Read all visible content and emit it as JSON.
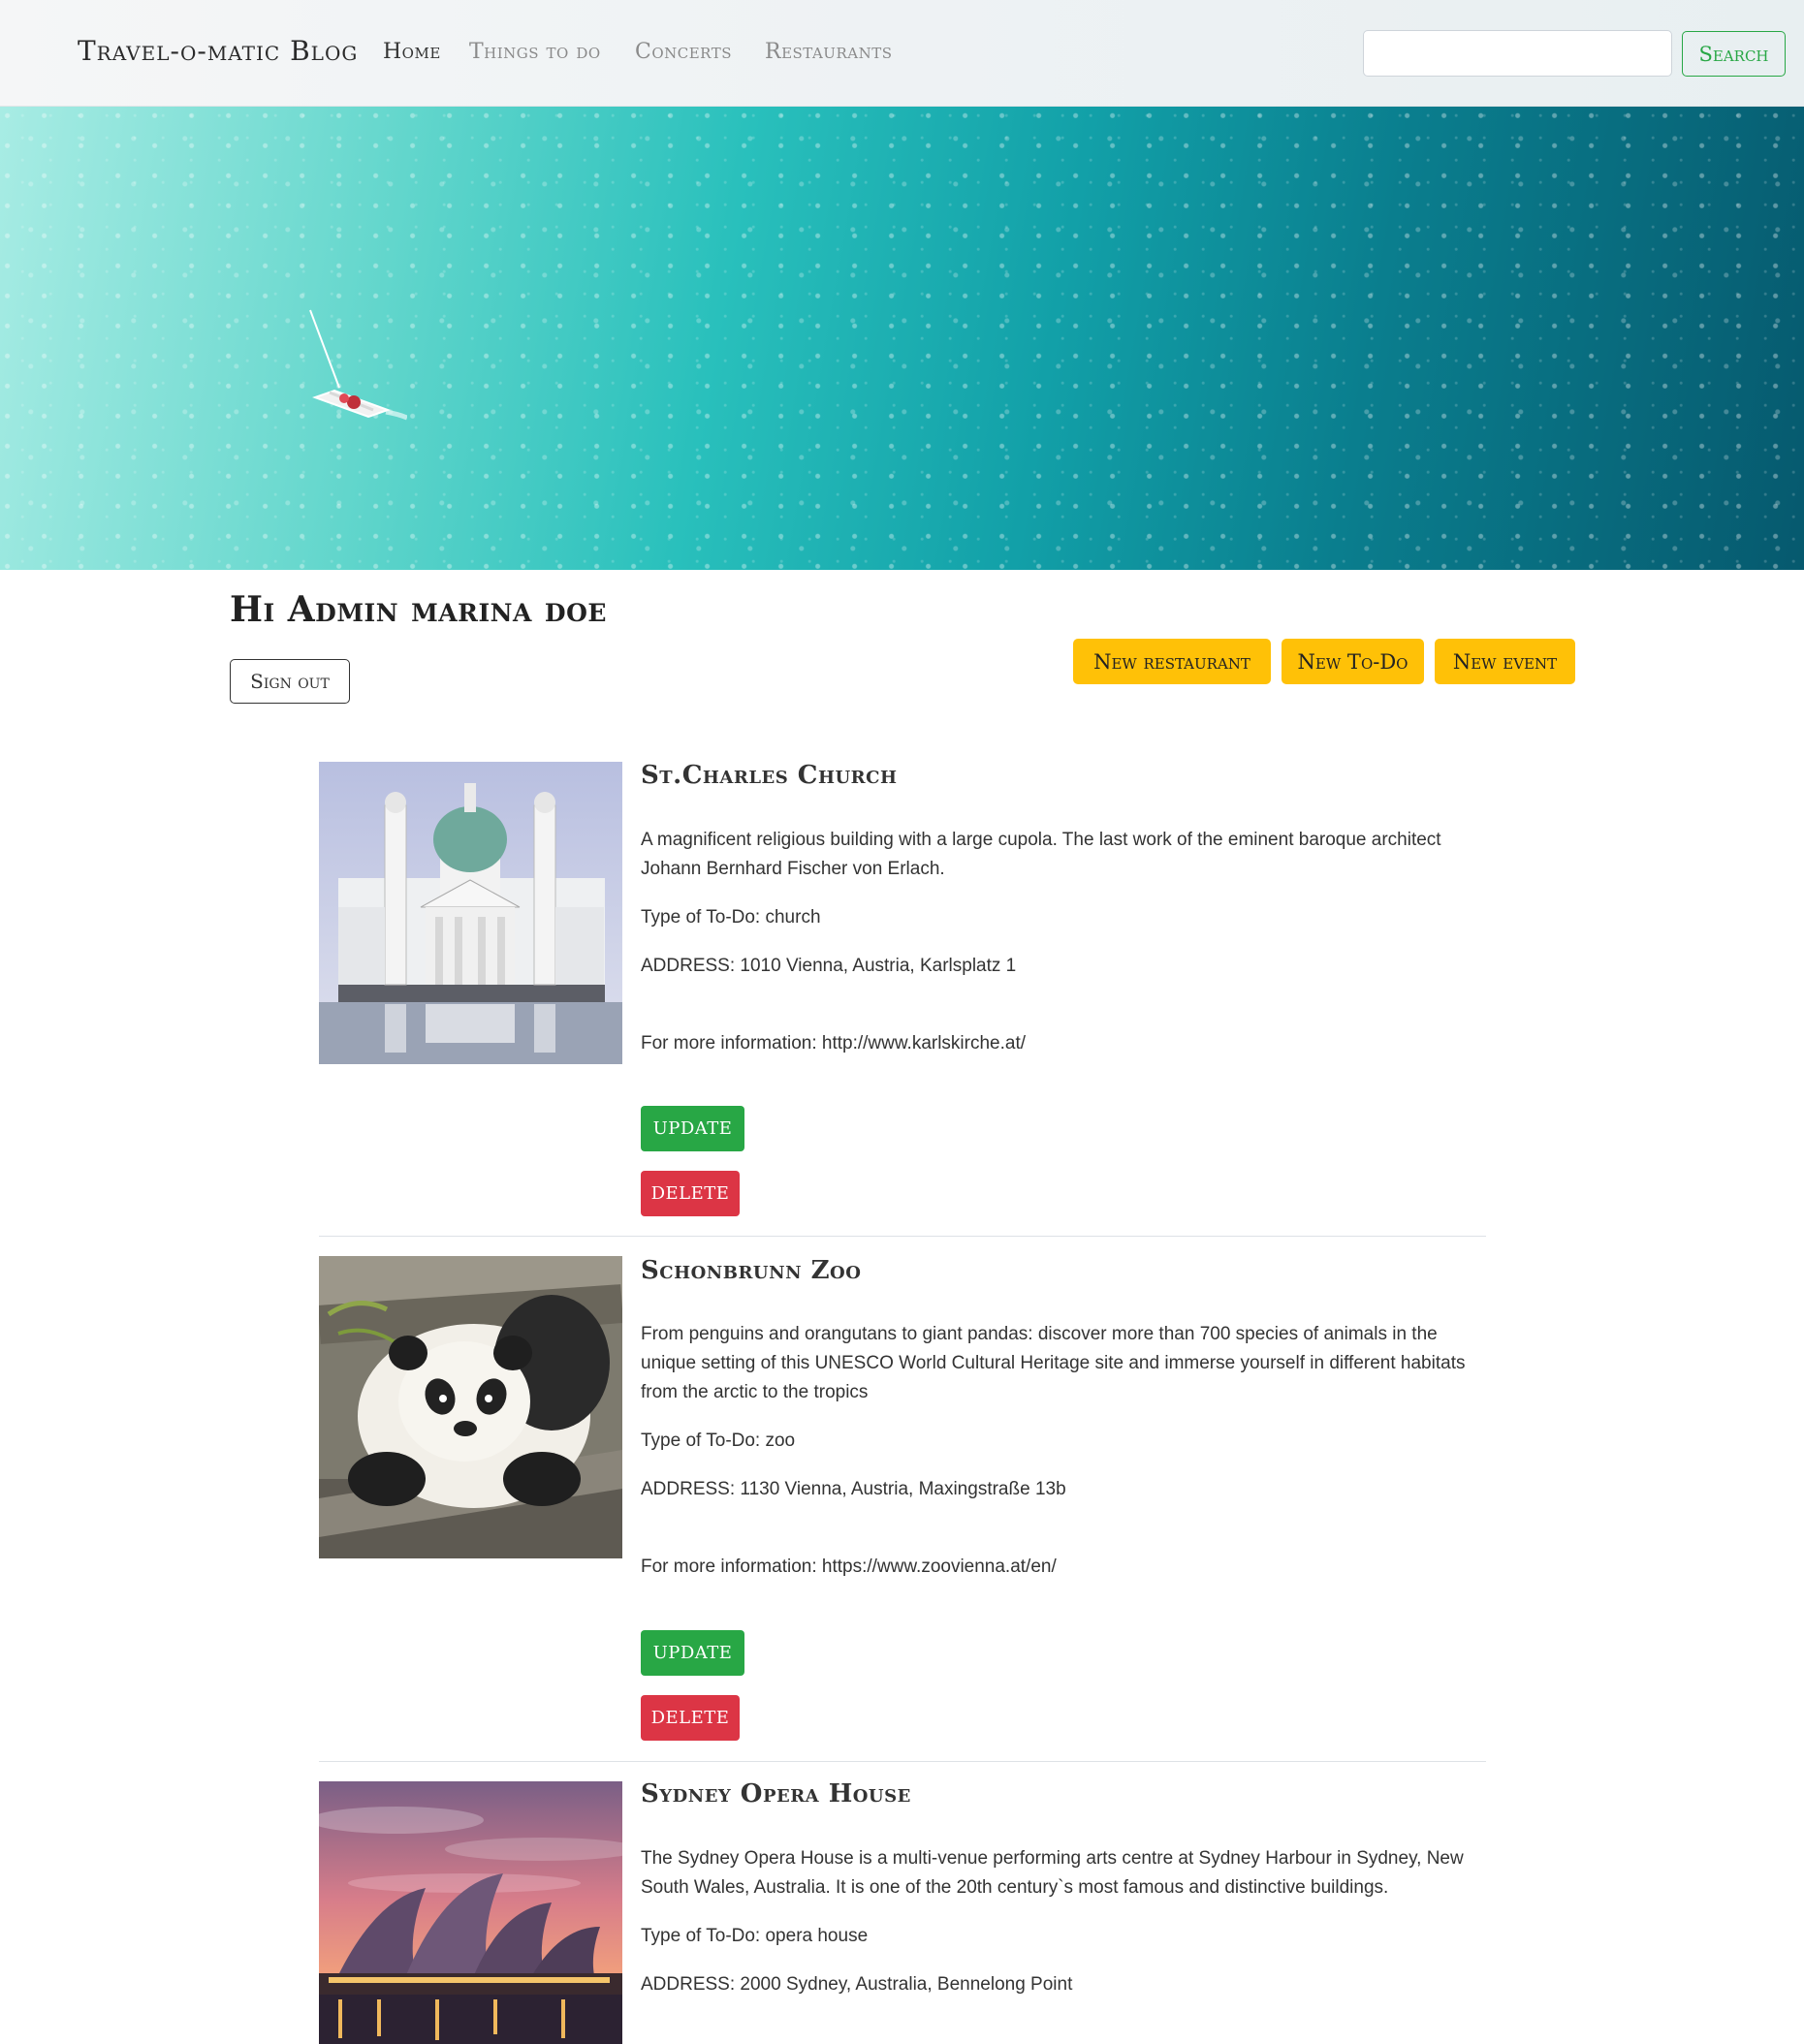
{
  "nav": {
    "brand": "Travel-o-matic Blog",
    "links": [
      "Home",
      "Things to do",
      "Concerts",
      "Restaurants"
    ],
    "active": "Home",
    "search_value": "",
    "search_button": "Search"
  },
  "greeting": {
    "text": "Hi Admin marina doe",
    "sign_out": "Sign out"
  },
  "actions": {
    "new_restaurant": "New restaurant",
    "new_todo": "New To-Do",
    "new_event": "New event"
  },
  "items": [
    {
      "title": "St.Charles Church",
      "description": "A magnificent religious building with a large cupola. The last work of the eminent baroque architect Johann Bernhard Fischer von Erlach.",
      "type": "Type of To-Do: church",
      "address": "ADDRESS: 1010 Vienna, Austria, Karlsplatz 1",
      "info": "For more information: http://www.karlskirche.at/",
      "update": "UPDATE",
      "delete": "DELETE",
      "image": "church-photo"
    },
    {
      "title": "Schonbrunn Zoo",
      "description": "From penguins and orangutans to giant pandas: discover more than 700 species of animals in the unique setting of this UNESCO World Cultural Heritage site and immerse yourself in different habitats from the arctic to the tropics",
      "type": "Type of To-Do: zoo",
      "address": "ADDRESS: 1130 Vienna, Austria, Maxingstraße 13b",
      "info": "For more information: https://www.zoovienna.at/en/",
      "update": "UPDATE",
      "delete": "DELETE",
      "image": "panda-photo"
    },
    {
      "title": "Sydney Opera House",
      "description": "The Sydney Opera House is a multi-venue performing arts centre at Sydney Harbour in Sydney, New South Wales, Australia. It is one of the 20th century`s most famous and distinctive buildings.",
      "type": "Type of To-Do: opera house",
      "address": "ADDRESS: 2000 Sydney, Australia, Bennelong Point",
      "image": "opera-house-photo"
    }
  ],
  "colors": {
    "success": "#28a745",
    "danger": "#dc3545",
    "warning": "#ffc107"
  }
}
